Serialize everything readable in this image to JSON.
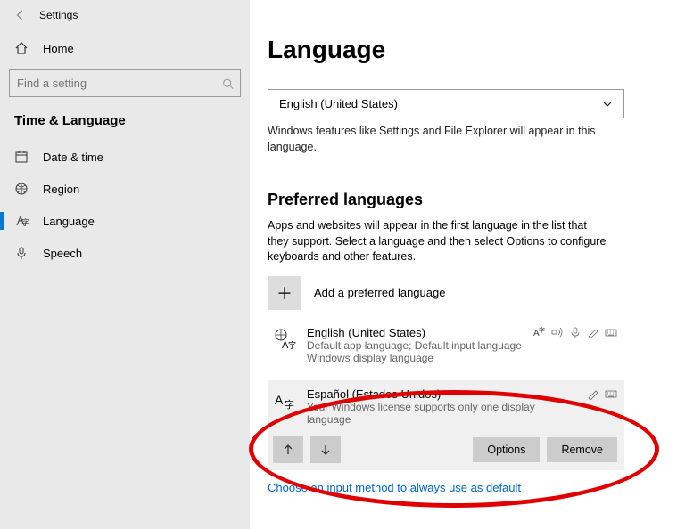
{
  "sidebar": {
    "app_title": "Settings",
    "home_label": "Home",
    "search_placeholder": "Find a setting",
    "section": "Time & Language",
    "items": [
      {
        "label": "Date & time",
        "icon": "calendar-icon"
      },
      {
        "label": "Region",
        "icon": "globe-icon"
      },
      {
        "label": "Language",
        "icon": "language-icon"
      },
      {
        "label": "Speech",
        "icon": "mic-icon"
      }
    ]
  },
  "page": {
    "title": "Language",
    "display_language": "English (United States)",
    "display_help": "Windows features like Settings and File Explorer will appear in this language.",
    "preferred_heading": "Preferred languages",
    "preferred_desc": "Apps and websites will appear in the first language in the list that they support. Select a language and then select Options to configure keyboards and other features.",
    "add_label": "Add a preferred language",
    "languages": [
      {
        "name": "English (United States)",
        "sub1": "Default app language; Default input language",
        "sub2": "Windows display language"
      },
      {
        "name": "Español (Estados Unidos)",
        "sub1": "Your Windows license supports only one display language"
      }
    ],
    "options_btn": "Options",
    "remove_btn": "Remove",
    "choose_link": "Choose an input method to always use as default"
  }
}
